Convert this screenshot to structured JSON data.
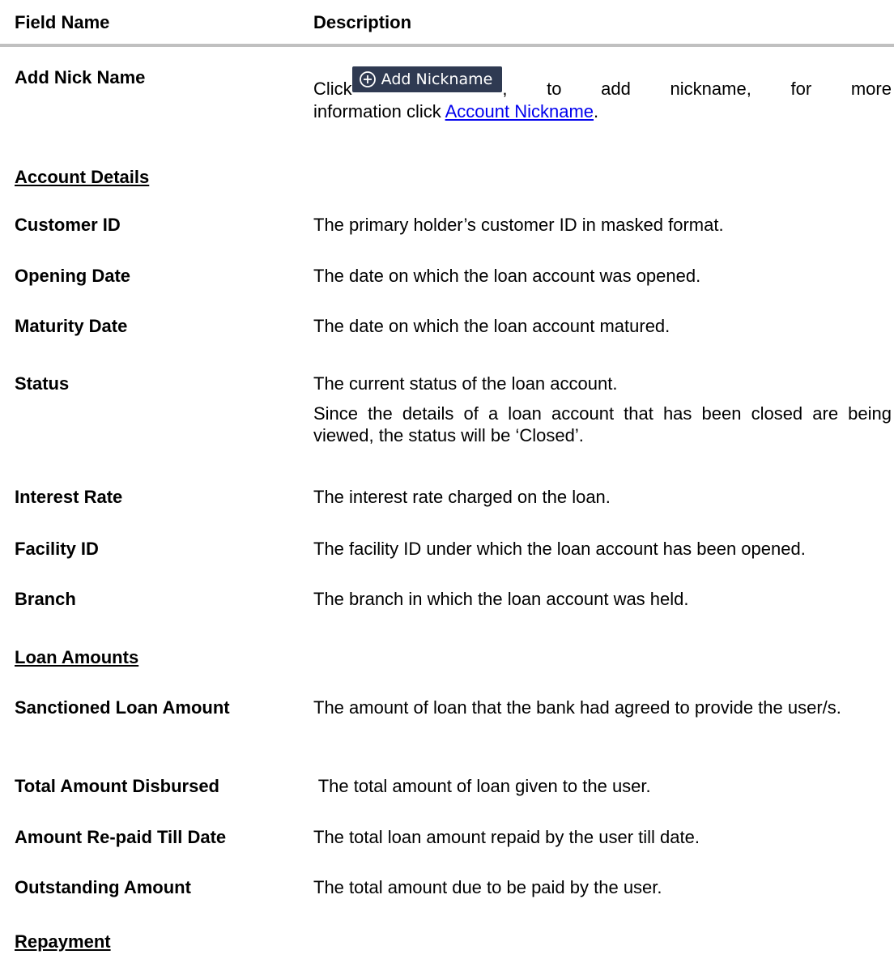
{
  "table": {
    "header": {
      "field": "Field Name",
      "description": "Description"
    },
    "nickname_row": {
      "field": "Add Nick Name",
      "click": "Click",
      "button_label": "Add Nickname",
      "after_button": ",",
      "w_to": "to",
      "w_add": "add",
      "w_nickname": "nickname,",
      "w_for": "for",
      "w_more": "more",
      "line2_prefix": "information click ",
      "link_text": "Account Nickname",
      "line2_suffix": "."
    },
    "sections": {
      "account_details": "Account Details",
      "loan_amounts": "Loan Amounts",
      "repayment": "Repayment"
    },
    "account_rows": [
      {
        "field": "Customer ID",
        "desc": "The primary holder’s customer ID in masked format."
      },
      {
        "field": "Opening Date",
        "desc": "The date on which the loan account was opened."
      },
      {
        "field": "Maturity Date",
        "desc": "The date on which the loan account matured."
      },
      {
        "field": "Status",
        "desc": "The current status of the loan account.",
        "desc2": "Since the details of a loan account that has been closed are being viewed, the status will be ‘Closed’."
      },
      {
        "field": "Interest Rate",
        "desc": "The interest rate charged on the loan."
      },
      {
        "field": "Facility ID",
        "desc": "The facility ID under which the loan account has been opened."
      },
      {
        "field": "Branch",
        "desc": "The branch in which the loan account was held."
      }
    ],
    "loan_rows": [
      {
        "field": "Sanctioned Loan Amount",
        "desc": "The amount of loan that the bank had agreed to provide the user/s."
      },
      {
        "field": "Total Amount Disbursed",
        "desc": " The total amount of loan given to the user."
      },
      {
        "field": "Amount Re-paid Till Date",
        "desc": "The total loan amount repaid by the user till date."
      },
      {
        "field": "Outstanding Amount",
        "desc": "The total amount due to be paid by the user."
      }
    ]
  },
  "icons": {
    "add_button_icon": "plus-circle-icon"
  },
  "colors": {
    "button_bg": "#2f3a52",
    "link": "#0000ee",
    "header_rule": "#c0c0c0"
  }
}
